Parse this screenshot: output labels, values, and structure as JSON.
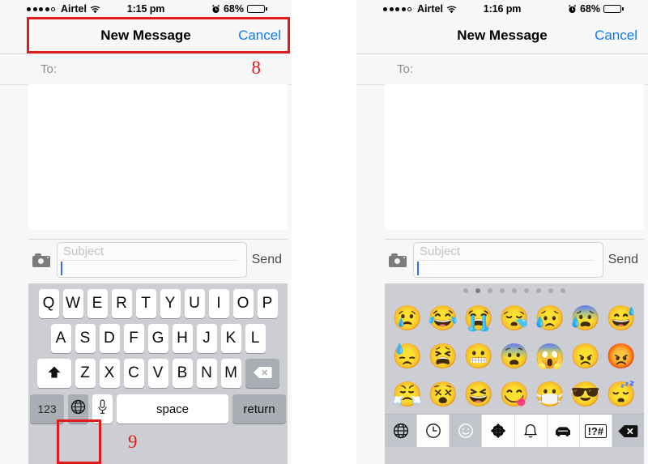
{
  "screens": [
    {
      "id": "left",
      "status_bar": {
        "signal_dots_filled": 4,
        "signal_dots_empty": 1,
        "carrier": "Airtel",
        "wifi_icon": "wifi-icon",
        "time": "1:15 pm",
        "alarm_icon": "alarm-clock-icon",
        "battery_percent": "68%",
        "battery_level": 68
      },
      "nav": {
        "title": "New Message",
        "action_label": "Cancel"
      },
      "to_field": {
        "label": "To:",
        "value": ""
      },
      "subject_field": {
        "placeholder": "Subject",
        "value": ""
      },
      "camera_icon": "camera-icon",
      "send_label": "Send",
      "keyboard": {
        "type": "qwerty",
        "row1": [
          "Q",
          "W",
          "E",
          "R",
          "T",
          "Y",
          "U",
          "I",
          "O",
          "P"
        ],
        "row2": [
          "A",
          "S",
          "D",
          "F",
          "G",
          "H",
          "J",
          "K",
          "L"
        ],
        "row3_shift_icon": "shift-arrow-icon",
        "row3": [
          "Z",
          "X",
          "C",
          "V",
          "B",
          "N",
          "M"
        ],
        "row3_delete_icon": "delete-backspace-icon",
        "numbers_key": "123",
        "globe_icon": "globe-icon",
        "mic_icon": "microphone-icon",
        "space_key": "space",
        "return_key": "return"
      },
      "annotations": [
        {
          "name": "step-8",
          "label": "8"
        },
        {
          "name": "step-9",
          "label": "9"
        }
      ]
    },
    {
      "id": "right",
      "status_bar": {
        "signal_dots_filled": 4,
        "signal_dots_empty": 1,
        "carrier": "Airtel",
        "wifi_icon": "wifi-icon",
        "time": "1:16 pm",
        "alarm_icon": "alarm-clock-icon",
        "battery_percent": "68%",
        "battery_level": 68
      },
      "nav": {
        "title": "New Message",
        "action_label": "Cancel"
      },
      "to_field": {
        "label": "To:",
        "value": ""
      },
      "subject_field": {
        "placeholder": "Subject",
        "value": ""
      },
      "camera_icon": "camera-icon",
      "send_label": "Send",
      "emoji_keyboard": {
        "page_count": 9,
        "active_page": 2,
        "rows": [
          [
            "😢",
            "😂",
            "😭",
            "😪",
            "😥",
            "😰",
            "😅"
          ],
          [
            "😓",
            "😫",
            "😬",
            "😨",
            "😱",
            "😠",
            "😡"
          ],
          [
            "😤",
            "😵",
            "😆",
            "😋",
            "😷",
            "😎",
            "😴"
          ]
        ],
        "toolbar": [
          {
            "name": "globe-icon",
            "label": "globe",
            "selected": true
          },
          {
            "name": "clock-icon",
            "label": "recently-used",
            "selected": false
          },
          {
            "name": "smiley-icon",
            "label": "smileys",
            "selected": true
          },
          {
            "name": "flower-icon",
            "label": "nature",
            "selected": false
          },
          {
            "name": "bell-icon",
            "label": "objects",
            "selected": false
          },
          {
            "name": "car-icon",
            "label": "places",
            "selected": false
          },
          {
            "name": "symbols-icon",
            "label": "!?#",
            "selected": false
          },
          {
            "name": "delete-backspace-icon",
            "label": "delete",
            "selected": false
          }
        ]
      }
    }
  ],
  "colors": {
    "accent_blue": "#0b7bfd",
    "annotation_red": "#e01b1b",
    "keyboard_bg": "#ccced3",
    "key_white": "#ffffff",
    "key_dark": "#a9adb4",
    "panel_bg": "#f7f7f7"
  }
}
